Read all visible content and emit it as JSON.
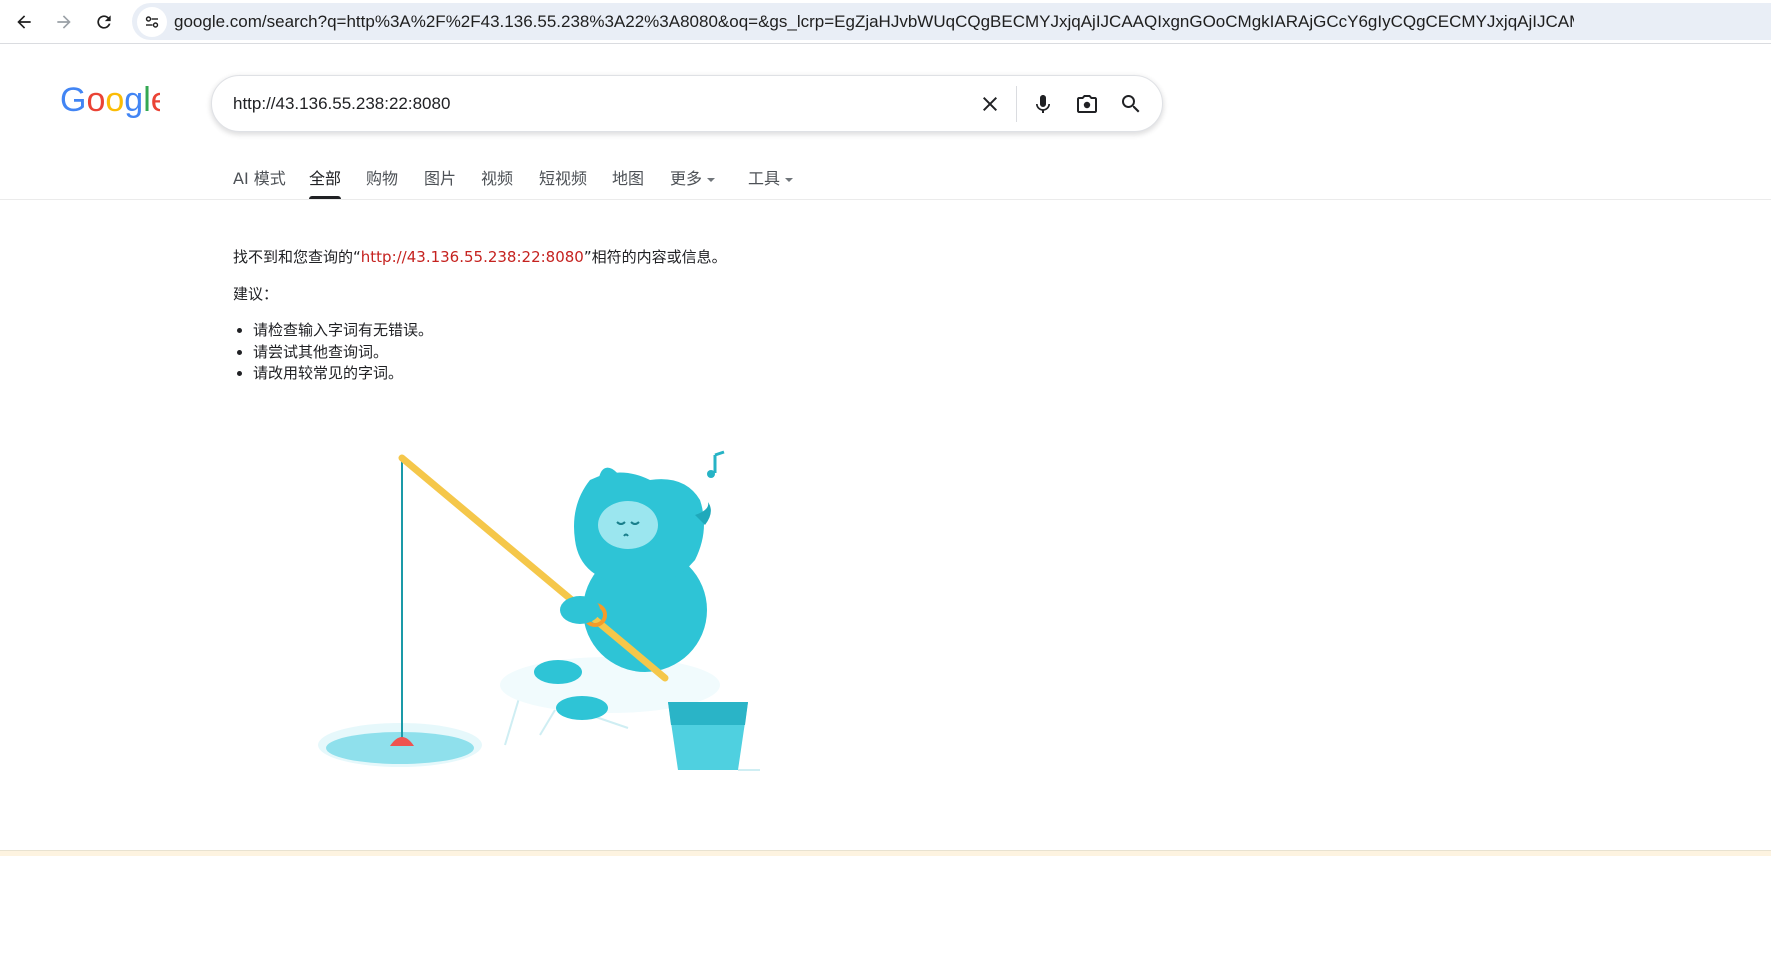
{
  "browser": {
    "url": "google.com/search?q=http%3A%2F%2F43.136.55.238%3A22%3A8080&oq=&gs_lcrp=EgZjaHJvbWUqCQgBECMYJxjqAjIJCAAQIxgnGOoCMgkIARAjGCcY6gIyCQgCECMYJxjqAjIJCAMQIx..."
  },
  "search": {
    "query": "http://43.136.55.238:22:8080"
  },
  "tabs": [
    {
      "label": "AI 模式"
    },
    {
      "label": "全部"
    },
    {
      "label": "购物"
    },
    {
      "label": "图片"
    },
    {
      "label": "视频"
    },
    {
      "label": "短视频"
    },
    {
      "label": "地图"
    },
    {
      "label": "更多"
    },
    {
      "label": "工具"
    }
  ],
  "no_results": {
    "prefix": "找不到和您查询的“",
    "query": "http://43.136.55.238:22:8080",
    "suffix": "”相符的内容或信息。",
    "suggestions_title": "建议：",
    "suggestions": [
      "请检查输入字词有无错误。",
      "请尝试其他查询词。",
      "请改用较常见的字词。"
    ]
  },
  "colors": {
    "accent_query": "#c5221f",
    "illustration_teal": "#2ec4d6",
    "rod_yellow": "#f5c74a"
  }
}
